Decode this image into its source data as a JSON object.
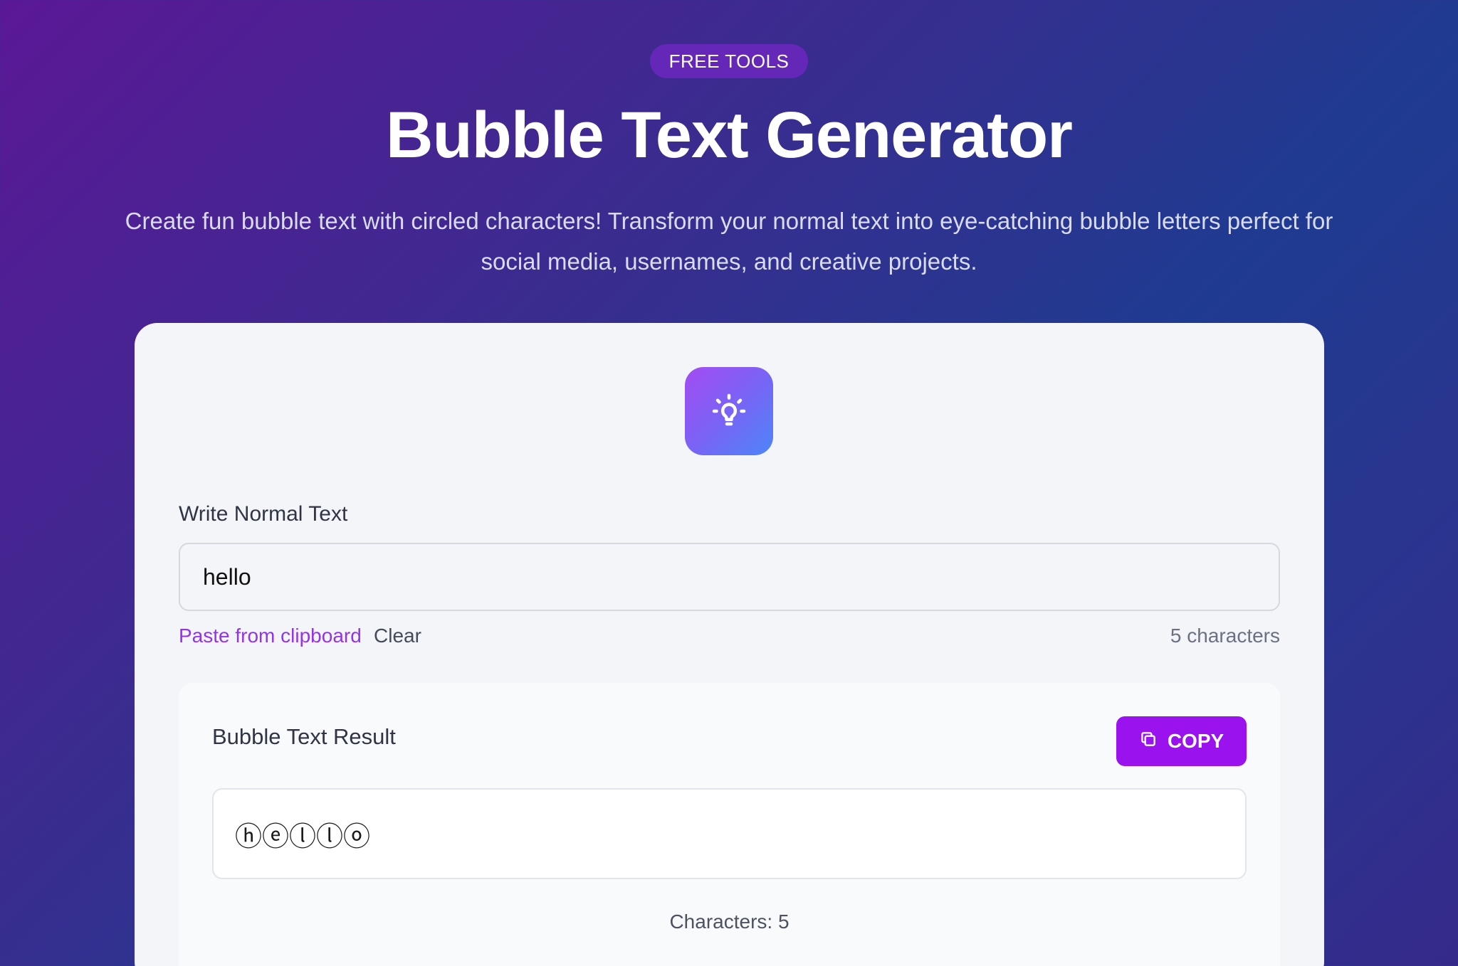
{
  "header": {
    "badge": "FREE TOOLS",
    "title": "Bubble Text Generator",
    "subtitle": "Create fun bubble text with circled characters! Transform your normal text into eye-catching bubble letters perfect for social media, usernames, and creative projects."
  },
  "tool": {
    "logo_icon": "lightbulb-icon",
    "input_label": "Write Normal Text",
    "input_value": "hello",
    "paste_label": "Paste from clipboard",
    "clear_label": "Clear",
    "char_count": "5 characters"
  },
  "result": {
    "label": "Bubble Text Result",
    "copy_label": "COPY",
    "copy_icon": "copy-icon",
    "output": "ⓗⓔⓛⓛⓞ",
    "char_count": "Characters: 5"
  },
  "colors": {
    "accent": "#9a12ee",
    "link": "#9333ea",
    "badge_bg": "#6527b8"
  }
}
